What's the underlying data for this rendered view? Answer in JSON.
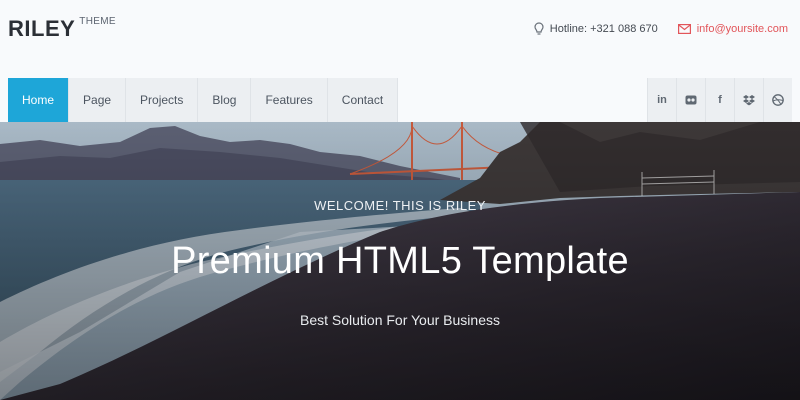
{
  "brand": {
    "name": "RILEY",
    "tagline": "THEME"
  },
  "contact": {
    "hotline": "Hotline: +321 088 670",
    "email": "info@yoursite.com"
  },
  "nav": {
    "items": [
      {
        "label": "Home",
        "active": true
      },
      {
        "label": "Page",
        "active": false
      },
      {
        "label": "Projects",
        "active": false
      },
      {
        "label": "Blog",
        "active": false
      },
      {
        "label": "Features",
        "active": false
      },
      {
        "label": "Contact",
        "active": false
      }
    ]
  },
  "social": [
    {
      "icon": "linkedin-icon",
      "glyph": "in"
    },
    {
      "icon": "flickr-icon",
      "glyph": "●●"
    },
    {
      "icon": "facebook-icon",
      "glyph": "f"
    },
    {
      "icon": "dropbox-icon",
      "glyph": "❖"
    },
    {
      "icon": "dribbble-icon",
      "glyph": "◍"
    }
  ],
  "hero": {
    "welcome": "WELCOME! THIS IS RILEY",
    "headline": "Premium HTML5 Template",
    "subline": "Best Solution For Your Business"
  },
  "colors": {
    "accent": "#1ea6d8",
    "email": "#e2555a",
    "nav_bg": "#eceff2"
  }
}
